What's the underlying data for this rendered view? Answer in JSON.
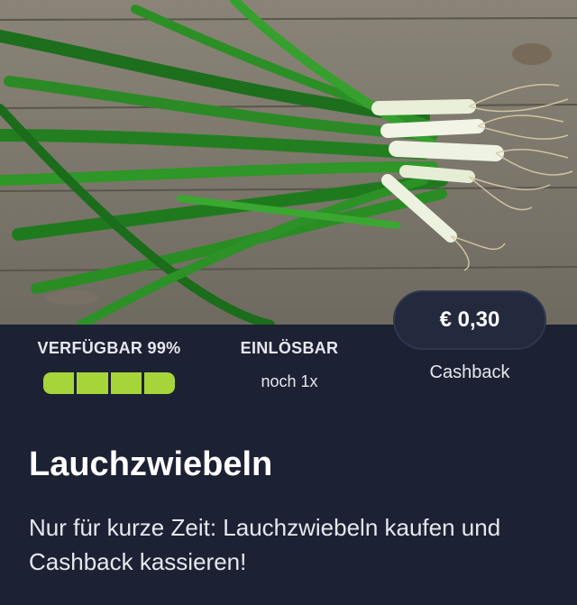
{
  "offer": {
    "image_subject": "green spring onions on a wooden table",
    "availability": {
      "label": "VERFÜGBAR 99%",
      "percent": 99,
      "segments": 4
    },
    "redeemable": {
      "label": "EINLÖSBAR",
      "value": "noch 1x"
    },
    "cashback": {
      "amount": "€ 0,30",
      "label": "Cashback"
    },
    "title": "Lauchzwiebeln",
    "description": "Nur für kurze Zeit: Lauchzwiebeln kaufen und Cashback kassieren!"
  },
  "colors": {
    "background": "#1c2133",
    "progress_fill": "#a6d53a",
    "pill_background": "#242a3e",
    "text": "#ffffff"
  }
}
